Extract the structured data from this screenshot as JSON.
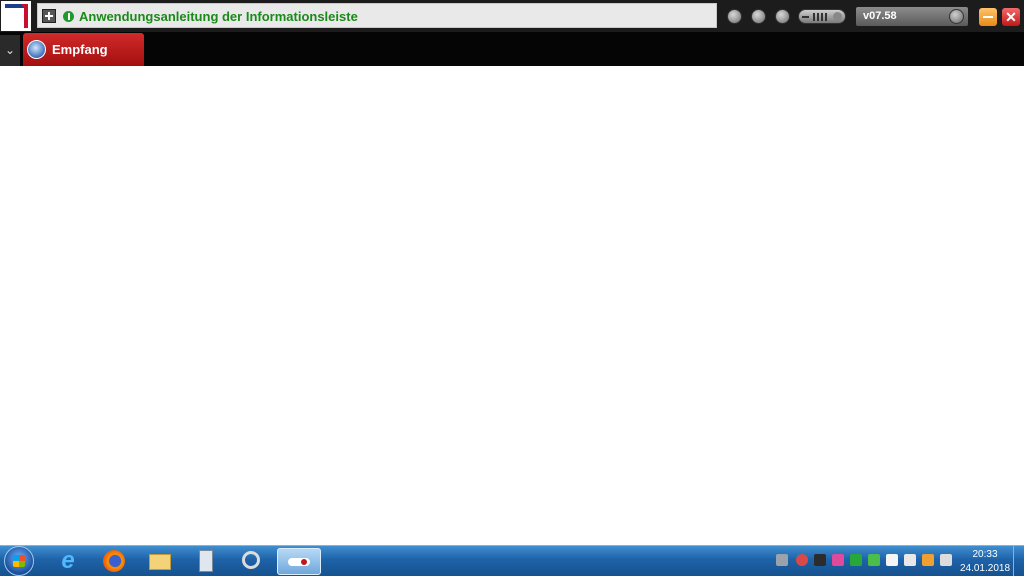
{
  "infobar": {
    "text": "Anwendungsanleitung der Informationsleiste"
  },
  "toolbar": {
    "version": "v07.58",
    "close_glyph": "✕"
  },
  "tabstrip": {
    "toggle_glyph": "⌄",
    "tabs": [
      {
        "label": "Empfang"
      }
    ]
  },
  "taskbar": {
    "ie_glyph": "e",
    "clock": {
      "time": "20:33",
      "date": "24.01.2018"
    }
  },
  "colors": {
    "infobar_text": "#1a8a1a",
    "tab_red": "#c01818",
    "taskbar_blue": "#1e62a8",
    "minimize_orange": "#f0a030"
  }
}
